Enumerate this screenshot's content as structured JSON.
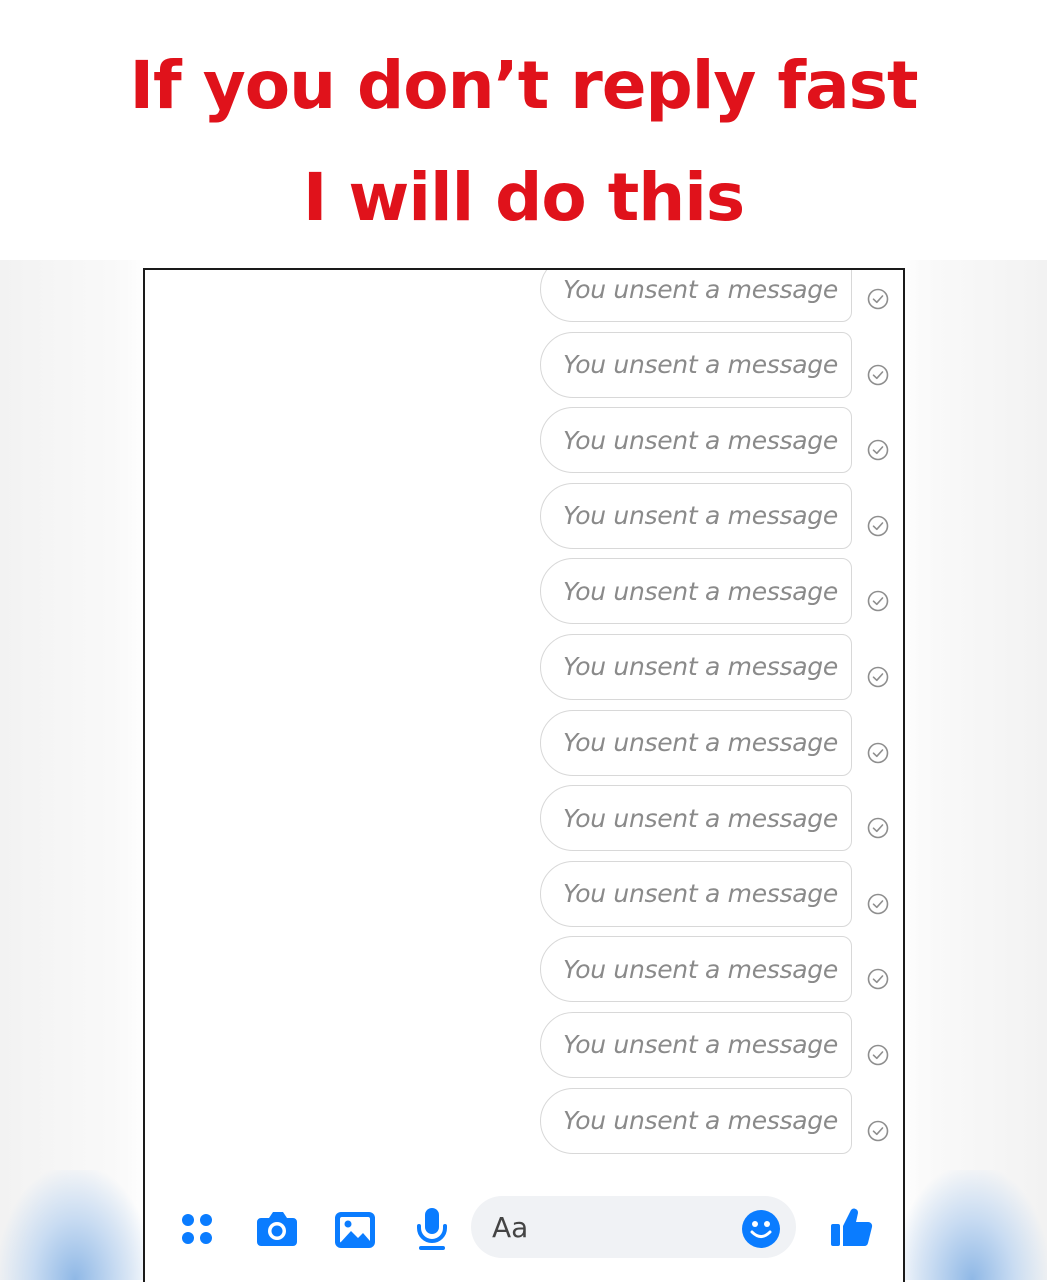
{
  "caption": {
    "line1": "If you don’t reply fast",
    "line2": "I will do this"
  },
  "messages": [
    {
      "text": "You unsent a message",
      "status_icon": "sent-check-icon"
    },
    {
      "text": "You unsent a message",
      "status_icon": "sent-check-icon"
    },
    {
      "text": "You unsent a message",
      "status_icon": "sent-check-icon"
    },
    {
      "text": "You unsent a message",
      "status_icon": "sent-check-icon"
    },
    {
      "text": "You unsent a message",
      "status_icon": "sent-check-icon"
    },
    {
      "text": "You unsent a message",
      "status_icon": "sent-check-icon"
    },
    {
      "text": "You unsent a message",
      "status_icon": "sent-check-icon"
    },
    {
      "text": "You unsent a message",
      "status_icon": "sent-check-icon"
    },
    {
      "text": "You unsent a message",
      "status_icon": "sent-check-icon"
    },
    {
      "text": "You unsent a message",
      "status_icon": "sent-check-icon"
    },
    {
      "text": "You unsent a message",
      "status_icon": "sent-check-icon"
    },
    {
      "text": "You unsent a message",
      "status_icon": "sent-check-icon"
    }
  ],
  "composer": {
    "placeholder": "Aa",
    "icons": [
      "menu-dots-icon",
      "camera-icon",
      "gallery-icon",
      "microphone-icon",
      "emoji-icon",
      "thumbs-up-icon"
    ]
  },
  "colors": {
    "caption_red": "#e0121b",
    "messenger_blue": "#0a7cff",
    "bubble_border": "#d8d8d8",
    "unsent_text": "#8a8a8a"
  }
}
